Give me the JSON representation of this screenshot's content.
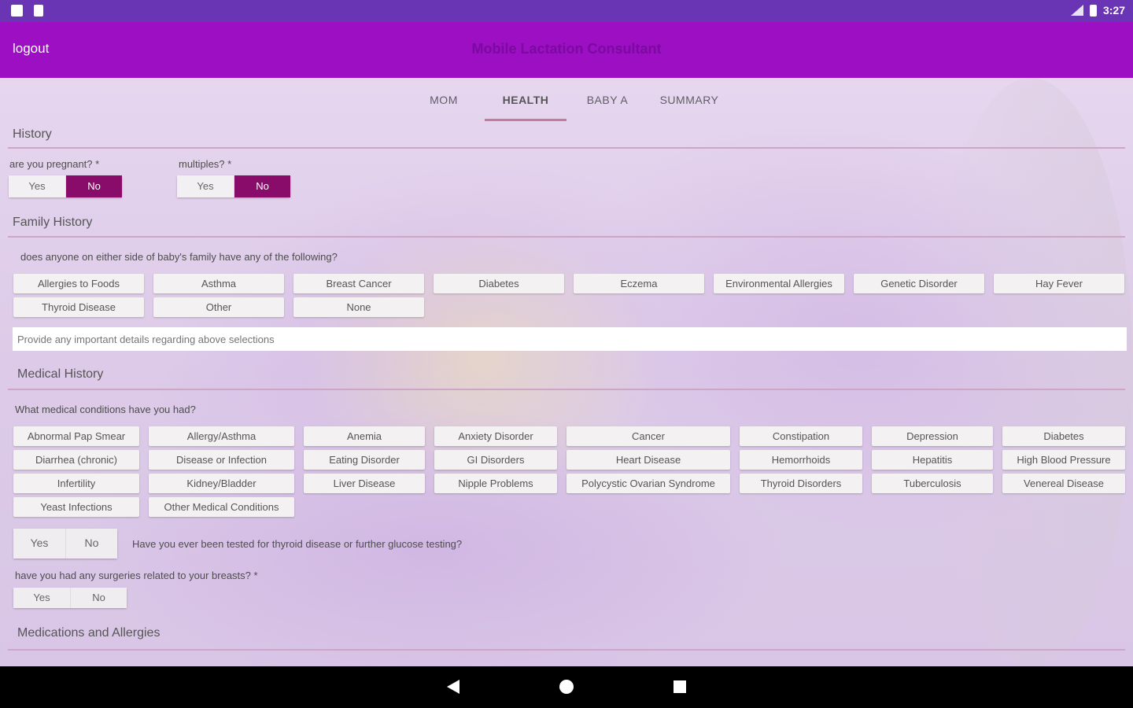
{
  "status_bar": {
    "time": "3:27",
    "icons": [
      "app-notification-icon",
      "clipboard-icon",
      "signal-icon",
      "battery-icon"
    ]
  },
  "toolbar": {
    "logout_label": "logout",
    "title": "Mobile Lactation Consultant"
  },
  "tabs": [
    {
      "label": "MOM",
      "active": false
    },
    {
      "label": "HEALTH",
      "active": true
    },
    {
      "label": "BABY A",
      "active": false
    },
    {
      "label": "SUMMARY",
      "active": false
    }
  ],
  "history": {
    "title": "History",
    "pregnant": {
      "question": "are you pregnant? *",
      "yes": "Yes",
      "no": "No",
      "selected": "No"
    },
    "multiples": {
      "question": "multiples? *",
      "yes": "Yes",
      "no": "No",
      "selected": "No"
    }
  },
  "family_history": {
    "title": "Family History",
    "question": "does anyone on either side of baby's family have any of the following?",
    "options": [
      "Allergies to Foods",
      "Asthma",
      "Breast Cancer",
      "Diabetes",
      "Eczema",
      "Environmental Allergies",
      "Genetic Disorder",
      "Hay Fever",
      "Thyroid Disease",
      "Other",
      "None"
    ],
    "details_placeholder": "Provide any important details regarding above selections"
  },
  "medical_history": {
    "title": "Medical History",
    "question": "What medical conditions have you had?",
    "options": [
      "Abnormal Pap Smear",
      "Allergy/Asthma",
      "Anemia",
      "Anxiety Disorder",
      "Cancer",
      "Constipation",
      "Depression",
      "Diabetes",
      "Diarrhea (chronic)",
      "Disease or Infection",
      "Eating Disorder",
      "GI Disorders",
      "Heart Disease",
      "Hemorrhoids",
      "Hepatitis",
      "High Blood Pressure",
      "Infertility",
      "Kidney/Bladder",
      "Liver Disease",
      "Nipple Problems",
      "Polycystic Ovarian Syndrome",
      "Thyroid Disorders",
      "Tuberculosis",
      "Venereal Disease",
      "Yeast Infections",
      "Other Medical Conditions"
    ],
    "thyroid_test": {
      "question": "Have you ever been tested for thyroid disease or further glucose testing?",
      "yes": "Yes",
      "no": "No"
    },
    "breast_surgery": {
      "question": "have you had any surgeries related to your breasts? *",
      "yes": "Yes",
      "no": "No"
    }
  },
  "medications": {
    "title": "Medications and Allergies"
  },
  "colors": {
    "status_bar": "#6a35b5",
    "toolbar": "#9c0fc2",
    "selected": "#8a0c6a",
    "divider": "#cda6c6"
  }
}
